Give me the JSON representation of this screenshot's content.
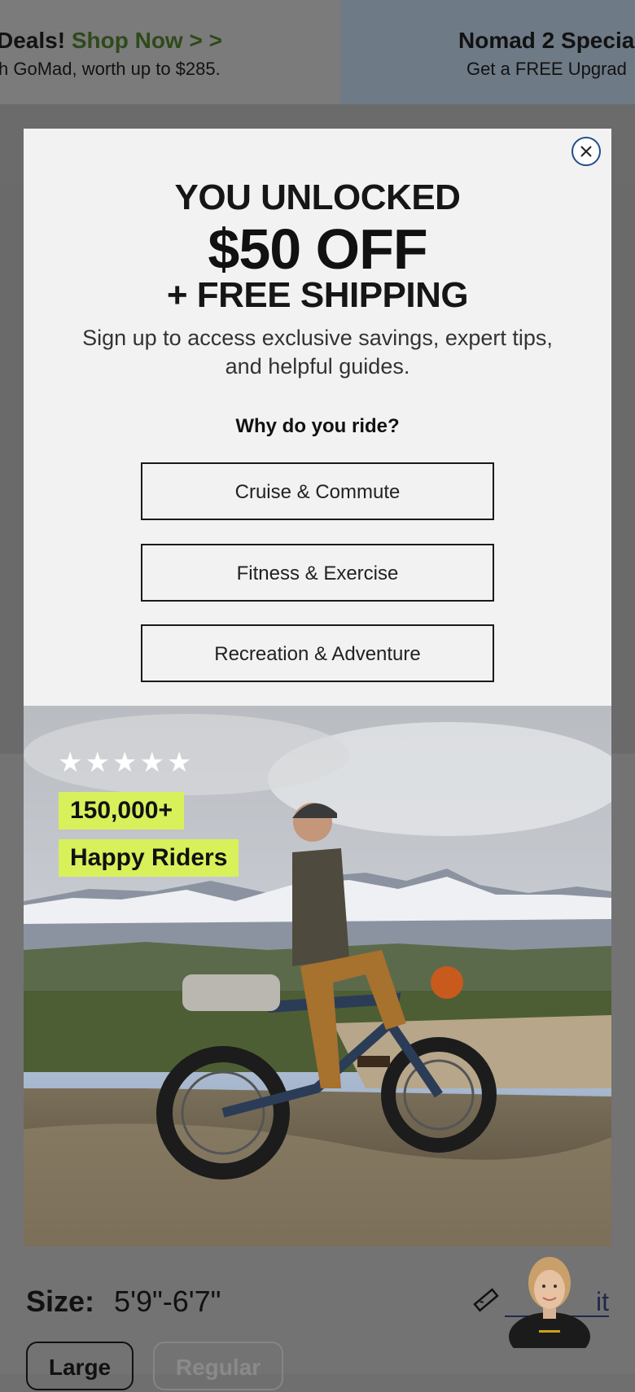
{
  "banner": {
    "left_title": "Deals!",
    "left_shop_now": "Shop Now > >",
    "left_subtitle": "h GoMad, worth up to $285.",
    "right_title": "Nomad 2 Specia",
    "right_subtitle": "Get a FREE Upgrad"
  },
  "product": {
    "size_label": "Size:",
    "size_value": "5'9\"-6'7\"",
    "size_guide_link": "it",
    "frame_options": [
      "Large",
      "Regular"
    ]
  },
  "popup": {
    "headline_1": "YOU UNLOCKED",
    "headline_2": "$50 OFF",
    "headline_3": "+ FREE SHIPPING",
    "subtext": "Sign up to access exclusive savings, expert tips, and helpful guides.",
    "question": "Why do you ride?",
    "options": [
      {
        "label": "Cruise & Commute"
      },
      {
        "label": "Fitness & Exercise"
      },
      {
        "label": "Recreation & Adventure"
      }
    ],
    "image": {
      "rating_stars": "★★★★★",
      "badge_count": "150,000+",
      "badge_label": "Happy Riders"
    }
  },
  "colors": {
    "badge_green": "#d8f05a",
    "close_ring": "#1f4f8a",
    "modal_bg": "#f2f2f2"
  },
  "icons": [
    "close-icon",
    "ruler-icon",
    "star-icon"
  ]
}
